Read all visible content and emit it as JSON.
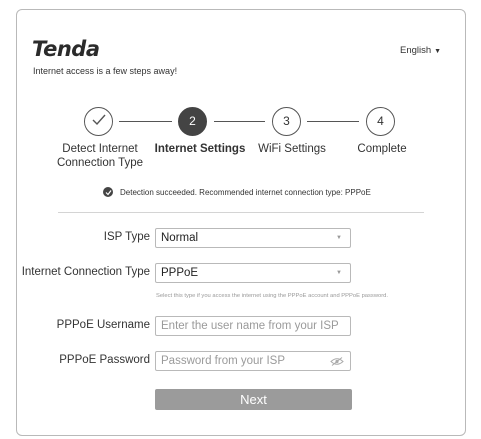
{
  "header": {
    "logo": "Tenda",
    "tagline": "Internet access is a few steps away!",
    "language": "English",
    "language_caret": "▼"
  },
  "steps": [
    {
      "number": "",
      "label": "Detect Internet Connection Type",
      "state": "done"
    },
    {
      "number": "2",
      "label": "Internet Settings",
      "state": "active"
    },
    {
      "number": "3",
      "label": "WiFi Settings",
      "state": "pending"
    },
    {
      "number": "4",
      "label": "Complete",
      "state": "pending"
    }
  ],
  "detection_message": "Detection succeeded. Recommended internet connection type: PPPoE",
  "form": {
    "isp_type_label": "ISP Type",
    "isp_type_value": "Normal",
    "connection_type_label": "Internet Connection Type",
    "connection_type_value": "PPPoE",
    "connection_hint": "Select this type if you access the internet using the PPPoE account and PPPoE password.",
    "username_label": "PPPoE Username",
    "username_placeholder": "Enter the user name from your ISP",
    "password_label": "PPPoE Password",
    "password_placeholder": "Password from your ISP",
    "dropdown_arrow": "▼"
  },
  "next_button": "Next",
  "icons": {
    "step_done": "checkmark-icon",
    "detect": "check-circle-icon",
    "password_toggle": "eye-slash-icon"
  },
  "colors": {
    "active_step": "#444444",
    "next_button": "#9b9b9b",
    "border": "#b9b9b9"
  }
}
